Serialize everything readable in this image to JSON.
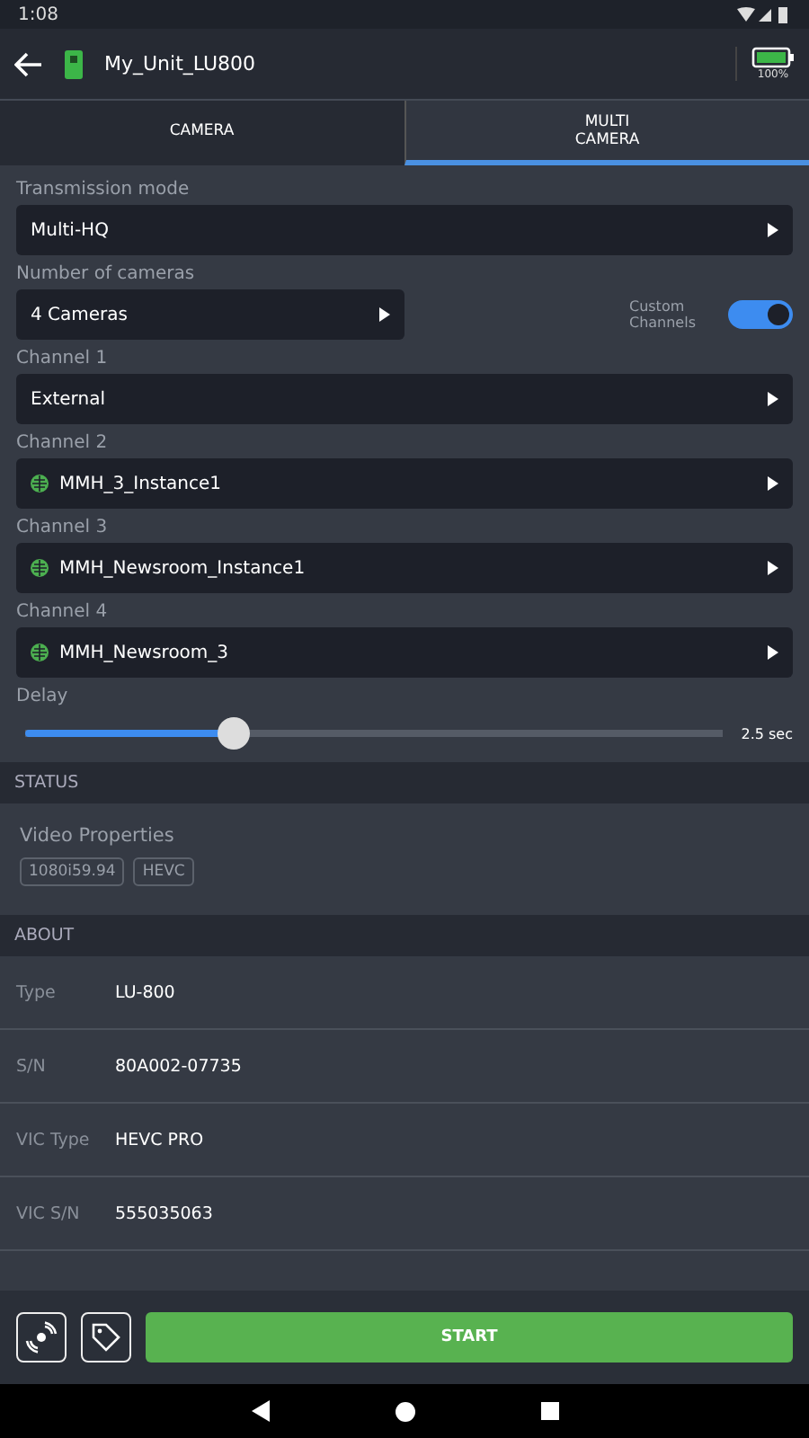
{
  "status_bar": {
    "time": "1:08"
  },
  "header": {
    "title": "My_Unit_LU800",
    "battery": "100%"
  },
  "tabs": [
    {
      "label": "CAMERA",
      "selected": false
    },
    {
      "label": "MULTI\nCAMERA",
      "selected": true
    }
  ],
  "form": {
    "transmission_label": "Transmission mode",
    "transmission_value": "Multi-HQ",
    "cameras_label": "Number of cameras",
    "cameras_value": "4 Cameras",
    "custom_channels": {
      "label": "Custom\nChannels",
      "on": true
    },
    "channels": [
      {
        "label": "Channel 1",
        "value": "External",
        "kind": "plain"
      },
      {
        "label": "Channel 2",
        "value": "MMH_3_Instance1",
        "kind": "stream"
      },
      {
        "label": "Channel 3",
        "value": "MMH_Newsroom_Instance1",
        "kind": "stream"
      },
      {
        "label": "Channel 4",
        "value": "MMH_Newsroom_3",
        "kind": "stream"
      }
    ],
    "delay": {
      "label": "Delay",
      "level": 0.29,
      "reading": "2.5 sec"
    }
  },
  "status": {
    "title": "STATUS",
    "subtitle": "Video Properties",
    "tags": [
      "1080i59.94",
      "HEVC"
    ]
  },
  "about": {
    "title": "ABOUT",
    "rows": [
      {
        "key": "Type",
        "value": "LU-800"
      },
      {
        "key": "S/N",
        "value": "80A002-07735"
      },
      {
        "key": "VIC Type",
        "value": "HEVC PRO"
      },
      {
        "key": "VIC S/N",
        "value": "555035063"
      }
    ]
  },
  "footer": {
    "start": "START"
  }
}
